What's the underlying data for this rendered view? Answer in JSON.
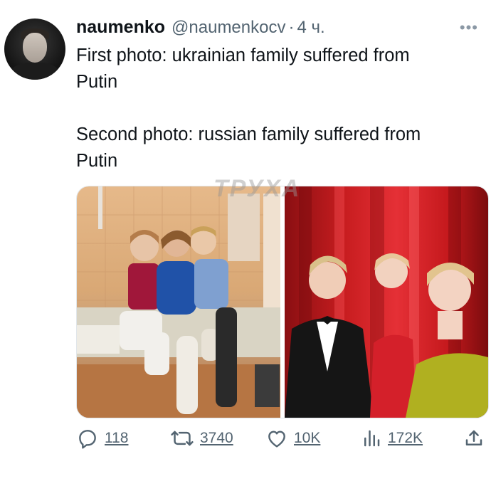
{
  "tweet": {
    "author_name": "naumenko",
    "author_handle": "@naumenkocv",
    "separator": "·",
    "time": "4 ч.",
    "more_label": "•••",
    "text_line1": "First photo: ukrainian family suffered from",
    "text_line2": "Putin",
    "text_line3": "Second photo: russian family suffered from",
    "text_line4": "Putin"
  },
  "media": {
    "watermark": "ТРУХА"
  },
  "actions": {
    "replies": "118",
    "retweets": "3740",
    "likes": "10K",
    "views": "172K"
  },
  "icons": [
    "reply-icon",
    "retweet-icon",
    "like-icon",
    "views-icon",
    "share-icon"
  ]
}
